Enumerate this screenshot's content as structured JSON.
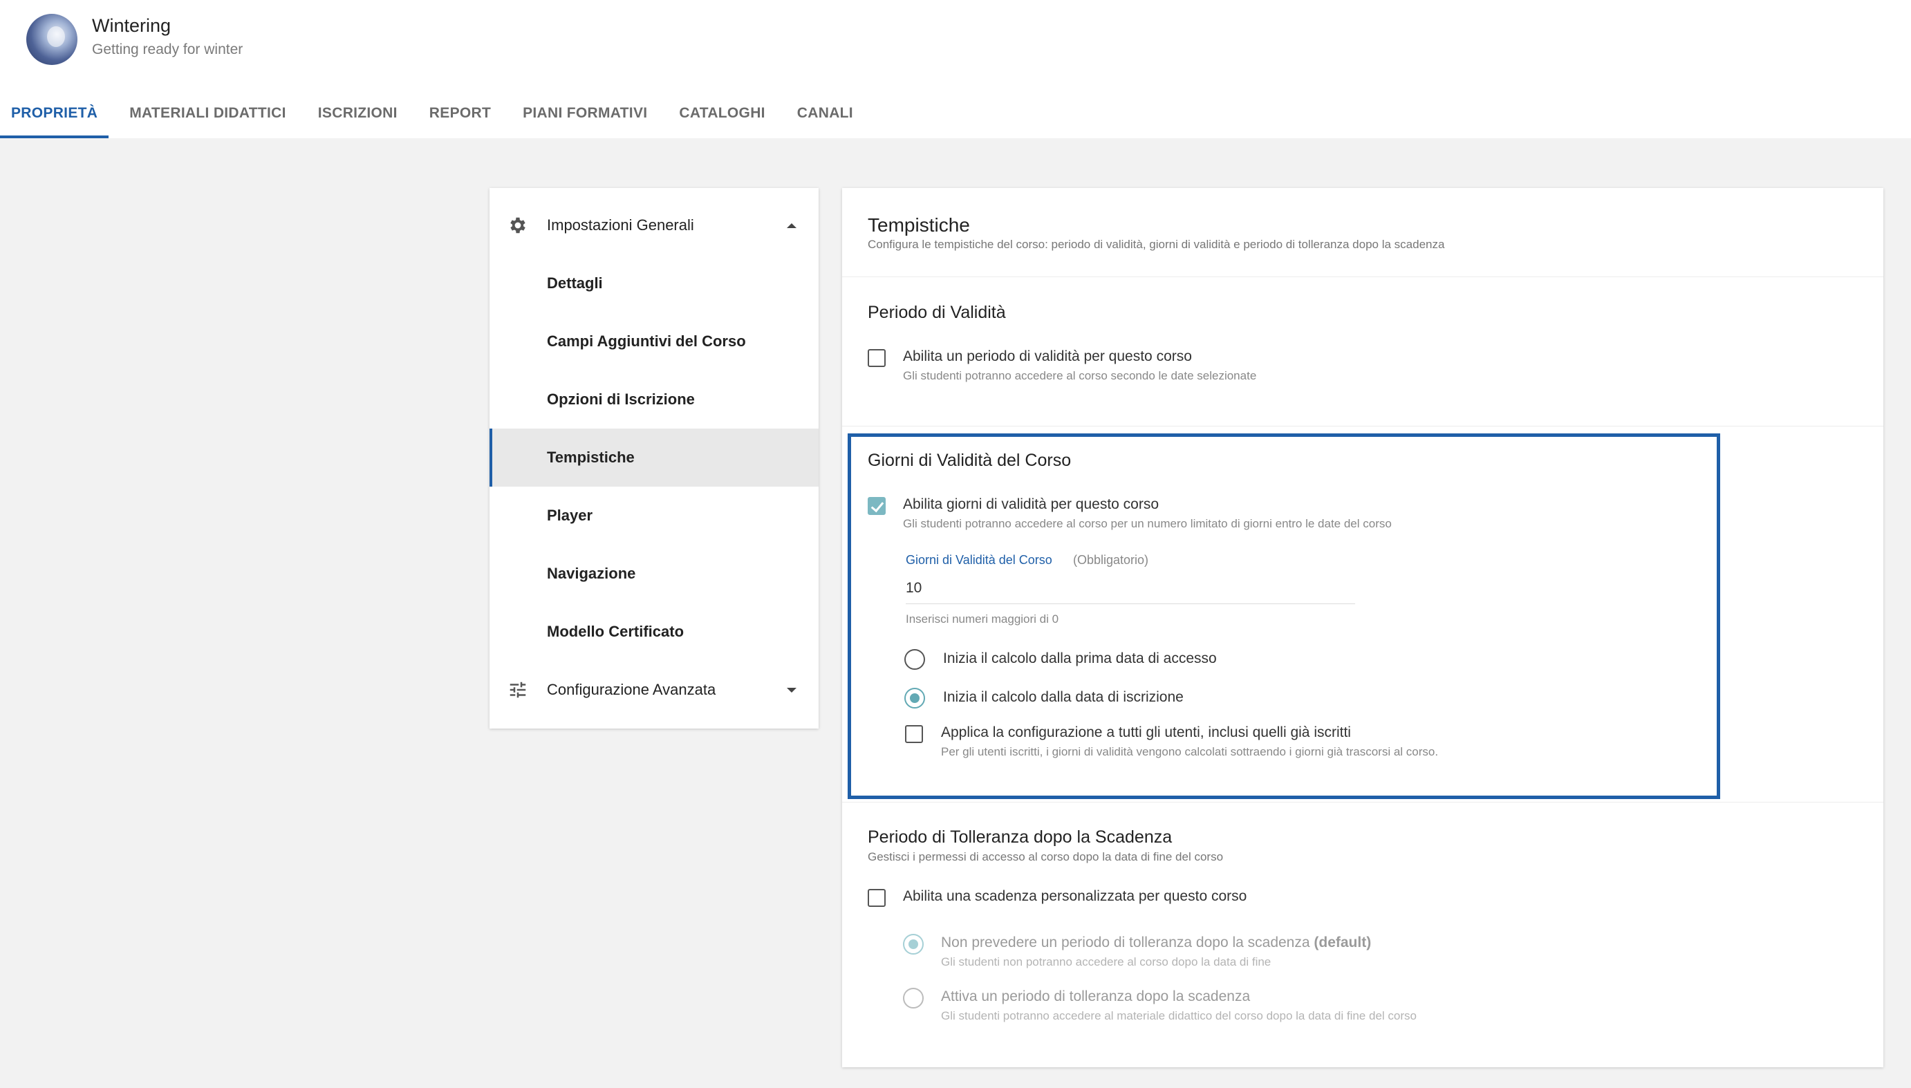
{
  "course": {
    "title": "Wintering",
    "subtitle": "Getting ready for winter"
  },
  "tabs": [
    {
      "label": "PROPRIETÀ",
      "active": true
    },
    {
      "label": "MATERIALI DIDATTICI",
      "active": false
    },
    {
      "label": "ISCRIZIONI",
      "active": false
    },
    {
      "label": "REPORT",
      "active": false
    },
    {
      "label": "PIANI FORMATIVI",
      "active": false
    },
    {
      "label": "CATALOGHI",
      "active": false
    },
    {
      "label": "CANALI",
      "active": false
    }
  ],
  "sidebar": {
    "general_group": {
      "label": "Impostazioni Generali",
      "icon": "gear-icon",
      "expanded": true
    },
    "items": [
      {
        "label": "Dettagli"
      },
      {
        "label": "Campi Aggiuntivi del Corso"
      },
      {
        "label": "Opzioni di Iscrizione"
      },
      {
        "label": "Tempistiche",
        "selected": true
      },
      {
        "label": "Player"
      },
      {
        "label": "Navigazione"
      },
      {
        "label": "Modello Certificato"
      }
    ],
    "advanced_group": {
      "label": "Configurazione Avanzata",
      "icon": "sliders-icon",
      "expanded": false
    }
  },
  "panel": {
    "title": "Tempistiche",
    "subtitle": "Configura le tempistiche del corso: periodo di validità, giorni di validità e periodo di tolleranza dopo la scadenza",
    "validity_period": {
      "title": "Periodo di Validità",
      "checkbox_label": "Abilita un periodo di validità per questo corso",
      "checkbox_help": "Gli studenti potranno accedere al corso secondo le date selezionate",
      "checked": false
    },
    "validity_days": {
      "title": "Giorni di Validità del Corso",
      "checkbox_label": "Abilita giorni di validità per questo corso",
      "checkbox_help": "Gli studenti potranno accedere al corso per un numero limitato di giorni entro le date del corso",
      "checked": true,
      "field_label": "Giorni di Validità del Corso",
      "field_required": "(Obbligatorio)",
      "field_value": "10",
      "field_hint": "Inserisci numeri maggiori di 0",
      "radio_first_access": "Inizia il calcolo dalla prima data di accesso",
      "radio_enrollment": "Inizia il calcolo dalla data di iscrizione",
      "apply_all_label": "Applica la configurazione a tutti gli utenti, inclusi quelli già iscritti",
      "apply_all_help": "Per gli utenti iscritti, i giorni di validità vengono calcolati sottraendo i giorni già trascorsi al corso."
    },
    "tolerance": {
      "title": "Periodo di Tolleranza dopo la Scadenza",
      "subtitle": "Gestisci i permessi di accesso al corso dopo la data di fine del corso",
      "checkbox_label": "Abilita una scadenza personalizzata per questo corso",
      "checked": false,
      "option_none_label": "Non prevedere un periodo di tolleranza dopo la scadenza",
      "option_none_default": "(default)",
      "option_none_help": "Gli studenti non potranno accedere al corso dopo la data di fine",
      "option_active_label": "Attiva un periodo di tolleranza dopo la scadenza",
      "option_active_help": "Gli studenti potranno accedere al materiale didattico del corso dopo la data di fine del corso"
    }
  },
  "colors": {
    "accent": "#1f5fa8",
    "check": "#7cb8c2",
    "radio": "#62a9b4"
  }
}
